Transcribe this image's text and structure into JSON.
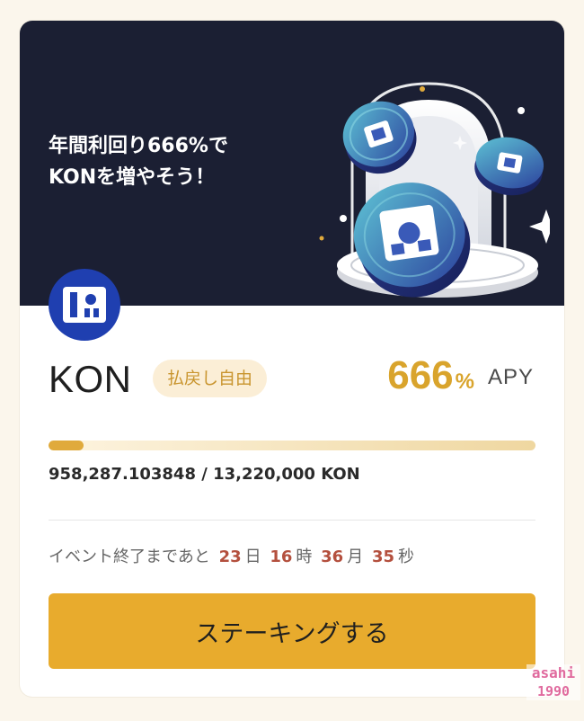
{
  "banner": {
    "line1": "年間利回り666%で",
    "line2": "KONを増やそう！"
  },
  "token": {
    "name": "KON",
    "badge": "払戻し自由",
    "logo_icon": "kon-logo-icon"
  },
  "apy": {
    "value": "666",
    "unit": "%",
    "label": "APY"
  },
  "progress": {
    "fraction": 0.0725,
    "supply_text": "958,287.103848 / 13,220,000 KON"
  },
  "countdown": {
    "prefix": "イベント終了まであと",
    "days": "23",
    "days_unit": "日",
    "hours": "16",
    "hours_unit": "時",
    "minutes": "36",
    "minutes_unit": "月",
    "seconds": "35",
    "seconds_unit": "秒"
  },
  "cta": {
    "label": "ステーキングする"
  },
  "watermark": {
    "line1": "asahi",
    "line2": "1990"
  },
  "colors": {
    "accent": "#e8ab2d",
    "banner_bg": "#1b1f33",
    "apy": "#d9a42c",
    "countdown_number": "#b4503e",
    "logo_bg": "#1f3fb0"
  }
}
